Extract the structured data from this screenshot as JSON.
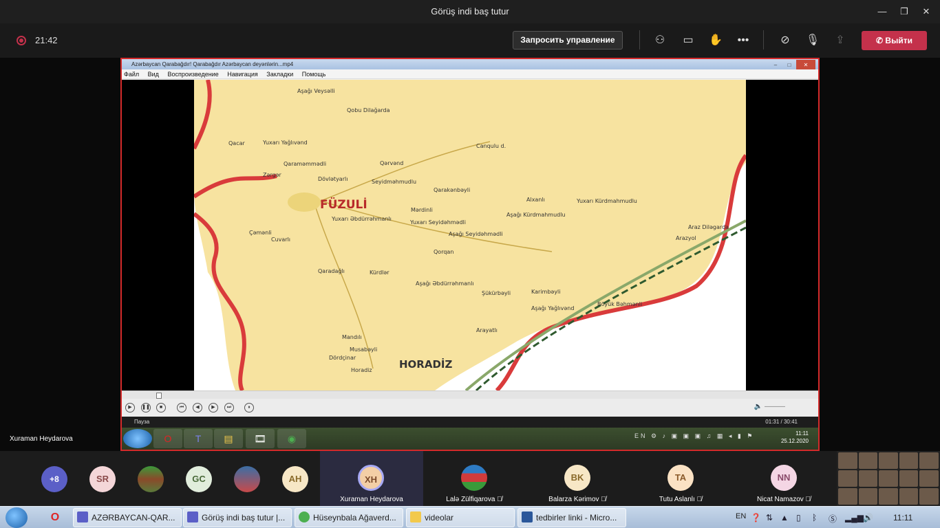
{
  "window": {
    "title": "Görüş indi baş tutur"
  },
  "meeting": {
    "timer": "21:42",
    "request_control_label": "Запросить управление",
    "leave_label": "Выйти",
    "presenter_name": "Xuraman Heydarova"
  },
  "player": {
    "title": "Azərbaycan Qarabağdır! Qarabağdır Azərbaycan deyənlərin...mp4",
    "menu": [
      "Файл",
      "Вид",
      "Воспроизведение",
      "Навигация",
      "Закладки",
      "Помощь"
    ],
    "status": "Пауза",
    "time": "01:31 / 30:41",
    "guest_clock_time": "11:11",
    "guest_clock_date": "25.12.2020",
    "guest_lang": "EN"
  },
  "map": {
    "city_main": "FÜZULİ",
    "city_secondary": "HORADİZ",
    "places": [
      "Aşağı Veysəlli",
      "Qobu Dilağarda",
      "Qacar",
      "Yuxarı Yağlıvənd",
      "Qaraməmmədli",
      "Qərvənd",
      "Dövlətyarlı",
      "Zərgər",
      "Seyidməhmudlu",
      "Qarakənbəyli",
      "Yuxarı Kürdmahmudlu",
      "Alxanlı",
      "Mərdinli",
      "Yuxarı Əbdürrəhmanlı",
      "Yuxarı Seyidəhmədli",
      "Aşağı Kürdmahmudlu",
      "Aşağı Seyidəhmədli",
      "Qorqan",
      "Cuvarlı",
      "Kürdlər",
      "Aşağı Əbdürrəhmanlı",
      "Çəmənli",
      "Qaradağlı",
      "Böyük Bəhmənli",
      "Şükürbəyli",
      "Karimbəyli",
      "Aşağı Yağlıvənd",
      "Arayatlı",
      "Mandılı",
      "Musabəyli",
      "Dördçinar",
      "Horadiz",
      "Canqulu d.",
      "Araz Diləgarda",
      "Arazyol"
    ]
  },
  "participants": {
    "overflow": "+8",
    "tiles": [
      {
        "initials": "SR",
        "name": ""
      },
      {
        "initials": "",
        "name": ""
      },
      {
        "initials": "GC",
        "name": ""
      },
      {
        "initials": "",
        "name": ""
      },
      {
        "initials": "AH",
        "name": ""
      },
      {
        "initials": "XH",
        "name": "Xuraman Heydarova"
      },
      {
        "initials": "",
        "name": "Lalə Zülfiqarova"
      },
      {
        "initials": "BK",
        "name": "Balarza Kərimov"
      },
      {
        "initials": "TA",
        "name": "Tutu Aslanlı"
      },
      {
        "initials": "NN",
        "name": "Nicat Namazov"
      }
    ]
  },
  "taskbar": {
    "tasks": [
      "AZƏRBAYCAN-QAR...",
      "Görüş indi baş tutur |...",
      "Hüseynbala Ağaverd...",
      "videolar",
      "tedbirler linki - Micro..."
    ],
    "lang": "EN",
    "time": "11:11"
  },
  "colors": {
    "leave": "#c4314b",
    "share_border": "#d42a2a",
    "active_tile": "#2b2b40"
  }
}
